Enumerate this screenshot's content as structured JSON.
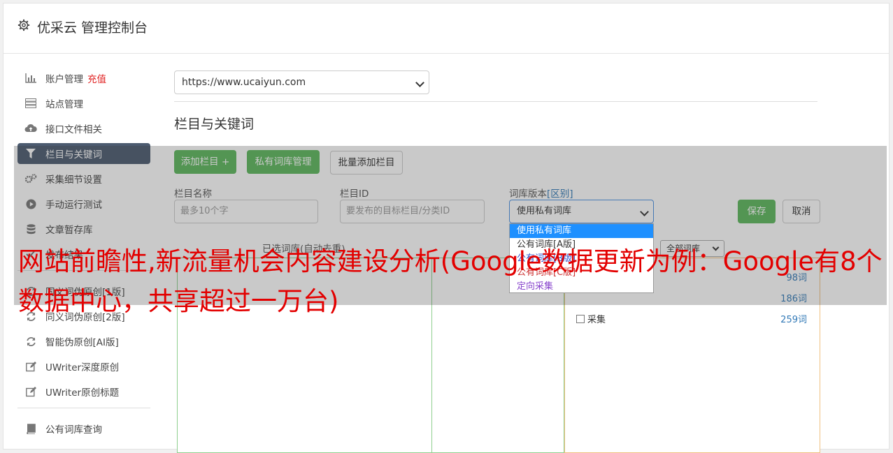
{
  "header": {
    "title": "优采云 管理控制台"
  },
  "sidebar": {
    "items": [
      {
        "label": "账户管理",
        "icon": "bar-chart-icon",
        "extra": "充值"
      },
      {
        "label": "站点管理",
        "icon": "server-icon"
      },
      {
        "label": "接口文件相关",
        "icon": "cloud-upload-icon"
      },
      {
        "label": "栏目与关键词",
        "icon": "filter-icon",
        "active": true
      },
      {
        "label": "采集细节设置",
        "icon": "gears-icon"
      },
      {
        "label": "手动运行测试",
        "icon": "play-circle-icon"
      },
      {
        "label": "文章暂存库",
        "icon": "database-icon"
      },
      {
        "label": "发布结果",
        "icon": "check-icon"
      },
      {
        "label": "同义词伪原创[1版]",
        "icon": "refresh-icon"
      },
      {
        "label": "同义词伪原创[2版]",
        "icon": "refresh-icon"
      },
      {
        "label": "智能伪原创[AI版]",
        "icon": "refresh-icon"
      },
      {
        "label": "UWriter深度原创",
        "icon": "edit-icon"
      },
      {
        "label": "UWriter原创标题",
        "icon": "edit-icon"
      },
      {
        "label": "公有词库查询",
        "icon": "book-icon"
      }
    ]
  },
  "main": {
    "site_select": "https://www.ucaiyun.com",
    "section_title": "栏目与关键词",
    "buttons": {
      "add_column": "添加栏目 +",
      "private_lib": "私有词库管理",
      "batch_add": "批量添加栏目",
      "save": "保存",
      "cancel": "取消"
    },
    "form": {
      "name_label": "栏目名称",
      "name_placeholder": "最多10个字",
      "id_label": "栏目ID",
      "id_placeholder": "要发布的目标栏目/分类ID",
      "version_label": "词库版本",
      "version_link": "[区别]",
      "version_value": "使用私有词库"
    },
    "dropdown_options": [
      "使用私有词库",
      "公有词库[A版]",
      "公有词库[B版]",
      "公有词库[C版]",
      "定向采集"
    ],
    "selected_words_title": "已选词库(自动去重)",
    "lib_filter": "全部词库",
    "word_rows": [
      {
        "label": "",
        "count": "98词"
      },
      {
        "label": "",
        "count": "186词"
      },
      {
        "label": "采集",
        "count": "259词"
      }
    ]
  },
  "headline": "网站前瞻性,新流量机会内容建设分析(Google数据更新为例：Google有8个数据中心，共享超过一万台)",
  "colors": {
    "active_nav": "#4c5b70",
    "green_button": "#5cb85c",
    "headline_red": "#e30000",
    "link_blue": "#337ab7"
  }
}
